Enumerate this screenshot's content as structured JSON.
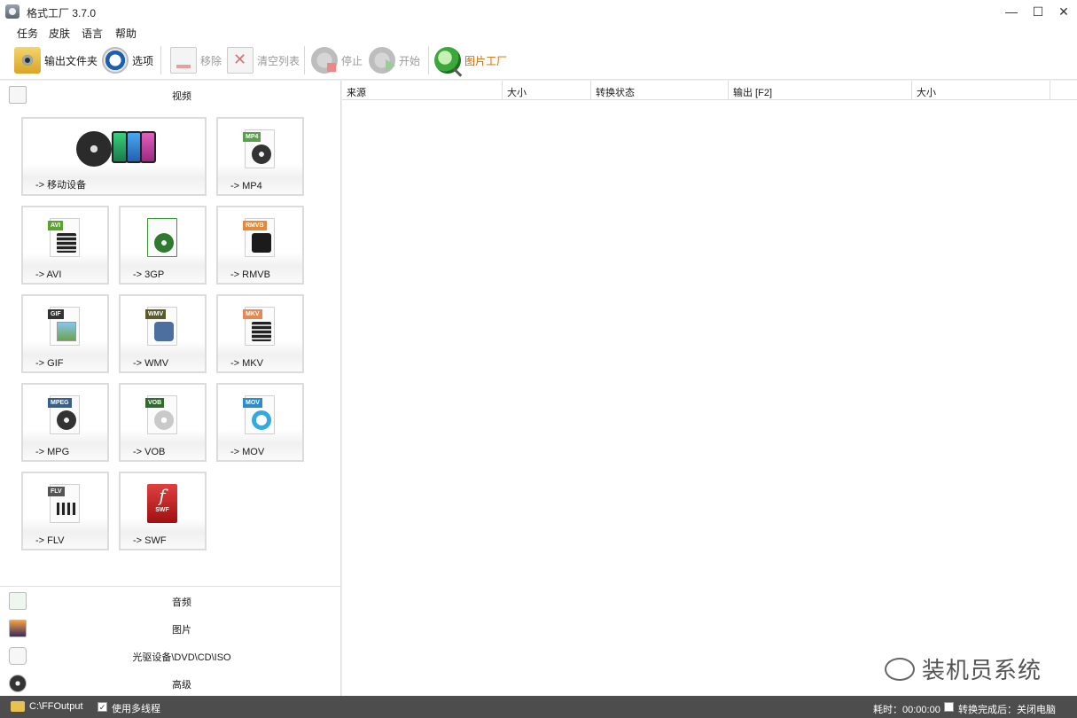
{
  "window": {
    "title": "格式工厂 3.7.0",
    "minimize": "—",
    "maximize": "☐",
    "close": "✕"
  },
  "menu": {
    "items": [
      "任务",
      "皮肤",
      "语言",
      "帮助"
    ]
  },
  "toolbar": {
    "output_folder": "输出文件夹",
    "options": "选项",
    "remove": "移除",
    "clear_list": "清空列表",
    "stop": "停止",
    "start": "开始",
    "picture_factory": "图片工厂"
  },
  "sidebar": {
    "video_header": "视频",
    "tiles": [
      {
        "label": "-> 移动设备"
      },
      {
        "label": "-> MP4",
        "badge": "MP4",
        "badge_color": "#5b9e4f"
      },
      {
        "label": "-> AVI",
        "badge": "AVI",
        "badge_color": "#5aa32f"
      },
      {
        "label": "-> 3GP"
      },
      {
        "label": "-> RMVB",
        "badge": "RMVB",
        "badge_color": "#e28a3c"
      },
      {
        "label": "-> GIF",
        "badge": "GIF",
        "badge_color": "#333333"
      },
      {
        "label": "-> WMV",
        "badge": "WMV",
        "badge_color": "#5b5a2a"
      },
      {
        "label": "-> MKV",
        "badge": "MKV",
        "badge_color": "#e08a5a"
      },
      {
        "label": "-> MPG",
        "badge": "MPEG",
        "badge_color": "#3a5e86"
      },
      {
        "label": "-> VOB",
        "badge": "VOB",
        "badge_color": "#2f6a2f"
      },
      {
        "label": "-> MOV",
        "badge": "MOV",
        "badge_color": "#2f8cc4"
      },
      {
        "label": "-> FLV",
        "badge": "FLV",
        "badge_color": "#555555"
      },
      {
        "label": "-> SWF",
        "badge": "SWF"
      }
    ],
    "categories": [
      "音频",
      "图片",
      "光驱设备\\DVD\\CD\\ISO",
      "高级"
    ]
  },
  "table": {
    "columns": [
      "来源",
      "大小",
      "转换状态",
      "输出 [F2]",
      "大小"
    ]
  },
  "watermark": "装机员系统",
  "status": {
    "output_path": "C:\\FFOutput",
    "multithread": "使用多线程",
    "elapsed": "耗时：00:00:00",
    "after_convert": "转换完成后：关闭电脑"
  }
}
